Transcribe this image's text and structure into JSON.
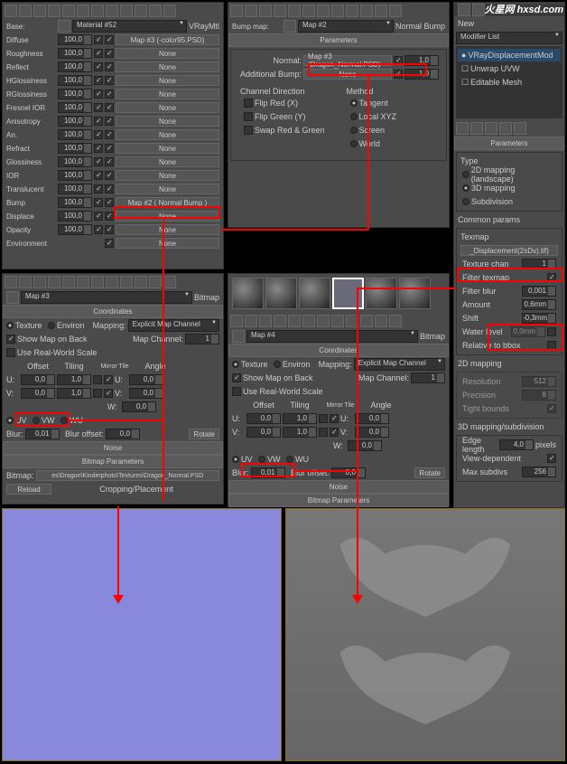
{
  "watermark": "火星网 hxsd.com",
  "panel1": {
    "base_lbl": "Base:",
    "material_name": "Material #52",
    "material_type": "VRayMtl",
    "rows": [
      {
        "label": "Diffuse",
        "spin": "100,0",
        "map": "Map #3 (-color95.PSD)"
      },
      {
        "label": "Roughness",
        "spin": "100,0",
        "map": "None"
      },
      {
        "label": "Reflect",
        "spin": "100,0",
        "map": "None"
      },
      {
        "label": "HGlossiness",
        "spin": "100,0",
        "map": "None"
      },
      {
        "label": "RGlossiness",
        "spin": "100,0",
        "map": "None"
      },
      {
        "label": "Fresnel IOR",
        "spin": "100,0",
        "map": "None"
      },
      {
        "label": "Anisotropy",
        "spin": "100,0",
        "map": "None"
      },
      {
        "label": "An.",
        "spin": "100,0",
        "map": "None"
      },
      {
        "label": "Refract",
        "spin": "100,0",
        "map": "None"
      },
      {
        "label": "Glossiness",
        "spin": "100,0",
        "map": "None"
      },
      {
        "label": "IOR",
        "spin": "100,0",
        "map": "None"
      },
      {
        "label": "Translucent",
        "spin": "100,0",
        "map": "None"
      },
      {
        "label": "Bump",
        "spin": "100,0",
        "map": "Map #2  ( Normal Bump )"
      },
      {
        "label": "Displace",
        "spin": "100,0",
        "map": "None"
      },
      {
        "label": "Opacity",
        "spin": "100,0",
        "map": "None"
      },
      {
        "label": "Environment",
        "spin": "",
        "map": "None"
      }
    ]
  },
  "panel2": {
    "bump_lbl": "Bump map:",
    "map_name": "Map #2",
    "map_type": "Normal Bump",
    "params_header": "Parameters",
    "normal_lbl": "Normal:",
    "normal_map": "Map #3 (Dragon_Normal.PSD)",
    "normal_spin": "1,0",
    "add_lbl": "Additional Bump:",
    "add_map": "None",
    "add_spin": "1,0",
    "chdir_lbl": "Channel Direction",
    "flipx": "Flip Red (X)",
    "flipy": "Flip Green (Y)",
    "swap": "Swap Red & Green",
    "method_lbl": "Method",
    "methods": [
      "Tangent",
      "Local XYZ",
      "Screen",
      "World"
    ]
  },
  "panel3": {
    "new_lbl": "New",
    "modlist": "Modifier List",
    "mods": [
      {
        "name": "VRayDisplacementMod",
        "icon": "●"
      },
      {
        "name": "Unwrap UVW",
        "icon": "☐"
      },
      {
        "name": "Editable Mesh",
        "icon": "☐"
      }
    ],
    "params": "Parameters",
    "type_lbl": "Type",
    "types": [
      "2D mapping (landscape)",
      "3D mapping",
      "Subdivision"
    ],
    "common": "Common params",
    "texmap": "Texmap",
    "texmap_btn": "_Displacement(2sDv).tif)",
    "texchan": "Texture chan",
    "texchan_v": "1",
    "filter_tex": "Filter texmap",
    "filter_blur": "Filter blur",
    "filter_blur_v": "0,001",
    "amount": "Amount",
    "amount_v": "0,6mm",
    "shift": "Shift",
    "shift_v": "-0,3mm",
    "water": "Water level",
    "water_v": "0,0mm",
    "relbbox": "Relative to bbox",
    "mapping2d": "2D mapping",
    "resolution": "Resolution",
    "resolution_v": "512",
    "precision": "Precision",
    "precision_v": "8",
    "tight": "Tight bounds",
    "mapping3d": "3D mapping/subdivision",
    "edge": "Edge length",
    "edge_v": "4,0",
    "px": "pixels",
    "viewdep": "View-dependent",
    "maxsub": "Max subdivs",
    "maxsub_v": "256"
  },
  "panel4": {
    "map_name": "Map #3",
    "map_type": "Bitmap",
    "coords": "Coordinates",
    "texture": "Texture",
    "environ": "Environ",
    "mapping_lbl": "Mapping:",
    "mapping": "Explicit Map Channel",
    "showmap": "Show Map on Back",
    "mapchan": "Map Channel:",
    "mapchan_v": "1",
    "realworld": "Use Real-World Scale",
    "col_offset": "Offset",
    "col_tiling": "Tiling",
    "col_mirror": "Mirror",
    "col_tile": "Tile",
    "col_angle": "Angle",
    "u": "U:",
    "v": "V:",
    "w": "W:",
    "offset_u": "0,0",
    "offset_v": "0,0",
    "tiling_u": "1,0",
    "tiling_v": "1,0",
    "angle_u": "0,0",
    "angle_v": "0,0",
    "angle_w": "0,0",
    "uv": "UV",
    "vw": "VW",
    "wu": "WU",
    "blur": "Blur:",
    "blur_v": "0,01",
    "bluroff": "Blur offset:",
    "bluroff_v": "0,0",
    "rotate": "Rotate",
    "noise": "Noise",
    "bmpparams": "Bitmap Parameters",
    "bitmap_lbl": "Bitmap:",
    "bitmap_path": "es\\Dragon\\Kinderphoto\\Textures\\Dragon_Normal.PSD",
    "reload": "Reload",
    "crop": "Cropping/Placement"
  },
  "panel5": {
    "map_name": "Map #4",
    "map_type": "Bitmap",
    "coords": "Coordinates",
    "texture": "Texture",
    "environ": "Environ",
    "mapping_lbl": "Mapping:",
    "mapping": "Explicit Map Channel",
    "showmap": "Show Map on Back",
    "mapchan": "Map Channel:",
    "mapchan_v": "1",
    "realworld": "Use Real-World Scale",
    "col_offset": "Offset",
    "col_tiling": "Tiling",
    "col_mirror": "Mirror",
    "col_tile": "Tile",
    "col_angle": "Angle",
    "u": "U:",
    "v": "V:",
    "w": "W:",
    "offset_u": "0,0",
    "offset_v": "0,0",
    "tiling_u": "1,0",
    "tiling_v": "1,0",
    "angle_u": "0,0",
    "angle_v": "0,0",
    "angle_w": "0,0",
    "uv": "UV",
    "vw": "VW",
    "wu": "WU",
    "blur": "Blur:",
    "blur_v": "0,01",
    "bluroff": "Blur offset:",
    "bluroff_v": "0,0",
    "rotate": "Rotate",
    "noise": "Noise",
    "bmpparams": "Bitmap Parameters"
  }
}
